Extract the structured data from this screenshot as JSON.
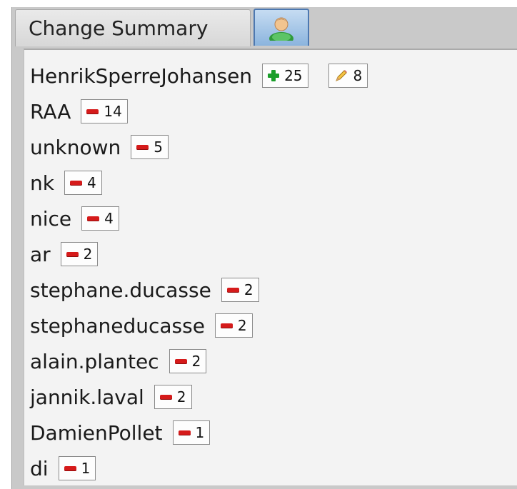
{
  "tabs": {
    "summary_label": "Change Summary",
    "user_tab_icon": "user-icon"
  },
  "contributors": [
    {
      "name": "HenrikSperreJohansen",
      "added": "25",
      "modified": "8"
    },
    {
      "name": "RAA",
      "removed": "14"
    },
    {
      "name": "unknown",
      "removed": "5"
    },
    {
      "name": "nk",
      "removed": "4"
    },
    {
      "name": "nice",
      "removed": "4"
    },
    {
      "name": "ar",
      "removed": "2"
    },
    {
      "name": "stephane.ducasse",
      "removed": "2"
    },
    {
      "name": "stephaneducasse",
      "removed": "2"
    },
    {
      "name": "alain.plantec",
      "removed": "2"
    },
    {
      "name": "jannik.laval",
      "removed": "2"
    },
    {
      "name": "DamienPollet",
      "removed": "1"
    },
    {
      "name": "di",
      "removed": "1"
    }
  ],
  "colors": {
    "removed": "#d51a1a",
    "added": "#1a9e2a",
    "selected_tab": "#8bb4de"
  }
}
